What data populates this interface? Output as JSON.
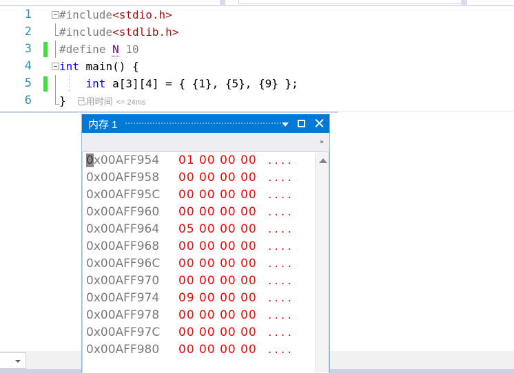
{
  "editor": {
    "lines": [
      {
        "number": "1",
        "fold": "open",
        "changed": false,
        "tokens": [
          {
            "t": "#include",
            "c": "pre"
          },
          {
            "t": "<stdio.h>",
            "c": "str"
          }
        ]
      },
      {
        "number": "2",
        "fold": "line-end",
        "changed": false,
        "tokens": [
          {
            "t": "#include",
            "c": "pre"
          },
          {
            "t": "<stdlib.h>",
            "c": "str"
          }
        ]
      },
      {
        "number": "3",
        "fold": "none",
        "changed": true,
        "tokens": [
          {
            "t": "#define ",
            "c": "pre"
          },
          {
            "t": "N",
            "c": "mac"
          },
          {
            "t": " 10",
            "c": "pre"
          }
        ]
      },
      {
        "number": "4",
        "fold": "open",
        "changed": false,
        "tokens": [
          {
            "t": "int",
            "c": "kw"
          },
          {
            "t": " main() {",
            "c": "plain"
          }
        ]
      },
      {
        "number": "5",
        "fold": "none",
        "changed": true,
        "indent_guide": true,
        "tokens": [
          {
            "t": "    ",
            "c": "plain"
          },
          {
            "t": "int",
            "c": "kw"
          },
          {
            "t": " a[3][4] = { {1}, {5}, {9} };",
            "c": "plain"
          }
        ]
      },
      {
        "number": "6",
        "fold": "line-end",
        "changed": false,
        "closing_brace": "}",
        "elapsed_label": "已用时间",
        "elapsed_value": "<= 24ms"
      }
    ]
  },
  "status": {
    "zoom_value": "%"
  },
  "memory_window": {
    "title": "内存 1",
    "buttons": {
      "dropdown": "chevron-down-icon",
      "maximize": "maximize-icon",
      "close": "close-icon"
    },
    "toolbar_overflow": "»",
    "columns": [
      "address",
      "bytes",
      "ascii"
    ],
    "cursor_char": "0",
    "rows": [
      {
        "addr_rest": "x00AFF954",
        "bytes": "01 00 00 00",
        "ascii": "....",
        "selected": true
      },
      {
        "addr_rest": "x00AFF958",
        "bytes": "00 00 00 00",
        "ascii": "....",
        "selected": false
      },
      {
        "addr_rest": "x00AFF95C",
        "bytes": "00 00 00 00",
        "ascii": "....",
        "selected": false
      },
      {
        "addr_rest": "x00AFF960",
        "bytes": "00 00 00 00",
        "ascii": "....",
        "selected": false
      },
      {
        "addr_rest": "x00AFF964",
        "bytes": "05 00 00 00",
        "ascii": "....",
        "selected": false
      },
      {
        "addr_rest": "x00AFF968",
        "bytes": "00 00 00 00",
        "ascii": "....",
        "selected": false
      },
      {
        "addr_rest": "x00AFF96C",
        "bytes": "00 00 00 00",
        "ascii": "....",
        "selected": false
      },
      {
        "addr_rest": "x00AFF970",
        "bytes": "00 00 00 00",
        "ascii": "....",
        "selected": false
      },
      {
        "addr_rest": "x00AFF974",
        "bytes": "09 00 00 00",
        "ascii": "....",
        "selected": false
      },
      {
        "addr_rest": "x00AFF978",
        "bytes": "00 00 00 00",
        "ascii": "....",
        "selected": false
      },
      {
        "addr_rest": "x00AFF97C",
        "bytes": "00 00 00 00",
        "ascii": "....",
        "selected": false
      },
      {
        "addr_rest": "x00AFF980",
        "bytes": "00 00 00 00",
        "ascii": "....",
        "selected": false
      }
    ],
    "scrollbar": "scroll-up-icon"
  },
  "colors": {
    "title_bar": "#0078d4",
    "line_number": "#2b91af",
    "keyword": "#0000ff",
    "preprocessor": "#808080",
    "string": "#a31515",
    "macro": "#6f008a",
    "memory_byte": "#ff0000",
    "memory_address": "#7a7a7a",
    "change_bar": "#3fdf3f"
  }
}
